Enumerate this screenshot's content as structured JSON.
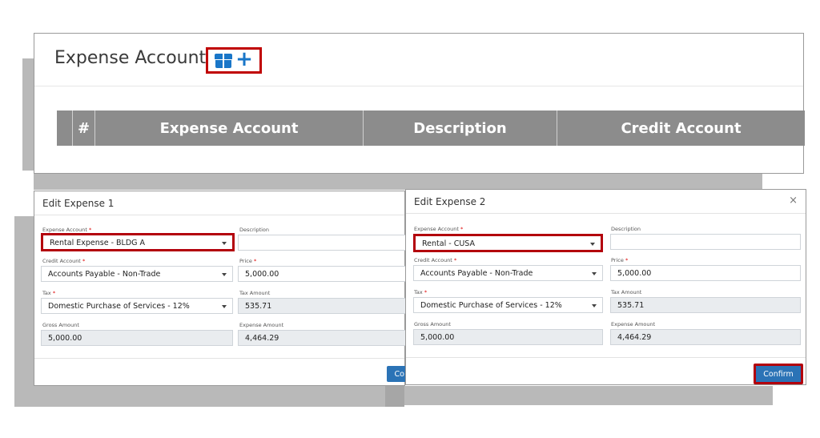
{
  "top_panel": {
    "title": "Expense Account",
    "table_headers": [
      "#",
      "Expense Account",
      "Description",
      "Credit Account"
    ]
  },
  "modal1": {
    "title": "Edit Expense 1",
    "expense_account_label": "Expense Account",
    "expense_account_value": "Rental Expense - BLDG A",
    "description_label": "Description",
    "description_value": "",
    "credit_account_label": "Credit Account",
    "credit_account_value": "Accounts Payable - Non-Trade",
    "price_label": "Price",
    "price_value": "5,000.00",
    "tax_label": "Tax",
    "tax_value": "Domestic Purchase of Services - 12%",
    "tax_amount_label": "Tax Amount",
    "tax_amount_value": "535.71",
    "gross_amount_label": "Gross Amount",
    "gross_amount_value": "5,000.00",
    "expense_amount_label": "Expense Amount",
    "expense_amount_value": "4,464.29",
    "confirm_partial": "Co"
  },
  "modal2": {
    "title": "Edit Expense 2",
    "close_glyph": "×",
    "expense_account_label": "Expense Account",
    "expense_account_value": "Rental - CUSA",
    "description_label": "Description",
    "description_value": "",
    "credit_account_label": "Credit Account",
    "credit_account_value": "Accounts Payable - Non-Trade",
    "price_label": "Price",
    "price_value": "5,000.00",
    "tax_label": "Tax",
    "tax_value": "Domestic Purchase of Services - 12%",
    "tax_amount_label": "Tax Amount",
    "tax_amount_value": "535.71",
    "gross_amount_label": "Gross Amount",
    "gross_amount_value": "5,000.00",
    "expense_amount_label": "Expense Amount",
    "expense_amount_value": "4,464.29",
    "confirm_label": "Confirm"
  },
  "required_mark": "*",
  "colors": {
    "accent": "#1976c8",
    "highlight": "#b3000c",
    "header_bg": "#8c8c8c",
    "button": "#2b73b6"
  },
  "icons": [
    "box-icon",
    "plus-icon",
    "chevron-down-icon",
    "close-icon"
  ]
}
